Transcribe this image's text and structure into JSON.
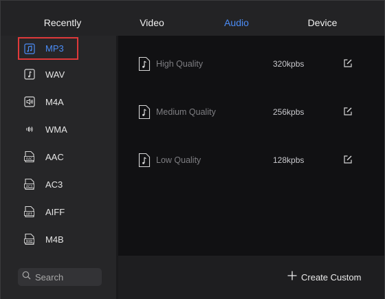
{
  "tabs": [
    {
      "label": "Recently",
      "active": false
    },
    {
      "label": "Video",
      "active": false
    },
    {
      "label": "Audio",
      "active": true
    },
    {
      "label": "Device",
      "active": false
    }
  ],
  "sidebar": {
    "formats": [
      {
        "label": "MP3",
        "icon": "music-note-icon",
        "selected": true
      },
      {
        "label": "WAV",
        "icon": "music-note-icon",
        "selected": false
      },
      {
        "label": "M4A",
        "icon": "speaker-icon",
        "selected": false
      },
      {
        "label": "WMA",
        "icon": "speaker-wave-icon",
        "selected": false
      },
      {
        "label": "AAC",
        "icon": "aac-file-icon",
        "selected": false
      },
      {
        "label": "AC3",
        "icon": "ac3-file-icon",
        "selected": false
      },
      {
        "label": "AIFF",
        "icon": "aiff-file-icon",
        "selected": false
      },
      {
        "label": "M4B",
        "icon": "m4b-file-icon",
        "selected": false
      }
    ],
    "search_placeholder": "Search"
  },
  "presets": [
    {
      "name": "High Quality",
      "bitrate": "320kpbs"
    },
    {
      "name": "Medium Quality",
      "bitrate": "256kpbs"
    },
    {
      "name": "Low Quality",
      "bitrate": "128kpbs"
    }
  ],
  "footer": {
    "create_label": "Create Custom"
  },
  "colors": {
    "accent": "#4b8df8",
    "selection_border": "#e0393a"
  }
}
